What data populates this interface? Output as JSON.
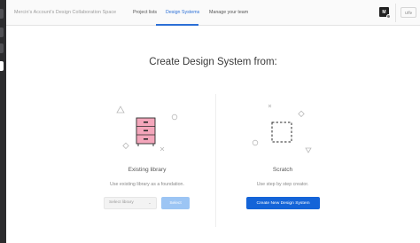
{
  "header": {
    "space_name": "Mercin's Account's Design Collaboration Space",
    "tabs": [
      {
        "label": "Project lists",
        "active": false
      },
      {
        "label": "Design Systems",
        "active": true
      },
      {
        "label": "Manage your team",
        "active": false
      }
    ],
    "avatar_initial": "M",
    "upgrade_label": "Uffe"
  },
  "main": {
    "headline": "Create Design System from:",
    "options": [
      {
        "title": "Existing library",
        "description": "Use existing library as a foundation.",
        "select_placeholder": "Select library",
        "button_label": "Select",
        "icon": "drawer-cabinet-icon"
      },
      {
        "title": "Scratch",
        "description": "Use step by step creator.",
        "button_label": "Create New Design System",
        "icon": "dashed-square-icon"
      }
    ]
  },
  "colors": {
    "accent": "#1464d8",
    "accent_disabled": "#9cc5f4",
    "cabinet": "#f4a6bb",
    "rail": "#2c2c2e"
  }
}
